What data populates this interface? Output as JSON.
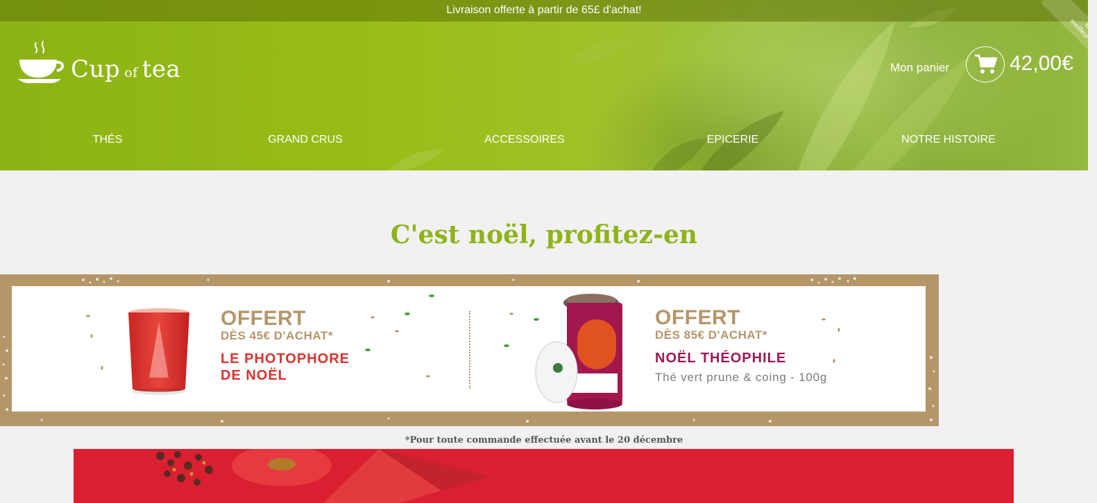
{
  "topbar": {
    "message": "Livraison offerte à partir de 65£ d'achat!"
  },
  "logo": {
    "word1": "Cup",
    "word2": "of",
    "word3": "tea"
  },
  "cart": {
    "label": "Mon panier",
    "total": "42,00€"
  },
  "ribbon": {
    "line1": "Élu",
    "line2": "meilleur thé"
  },
  "nav": {
    "items": [
      {
        "label": "THÉS"
      },
      {
        "label": "GRAND CRUS"
      },
      {
        "label": "ACCESSOIRES"
      },
      {
        "label": "EPICERIE"
      },
      {
        "label": "NOTRE HISTOIRE"
      }
    ]
  },
  "main": {
    "title": "C'est noël, profitez-en",
    "promo": {
      "left": {
        "title": "OFFERT",
        "subtitle": "DÈS 45€ D'ACHAT*",
        "name_line1": "LE PHOTOPHORE",
        "name_line2": "DE NOËL"
      },
      "right": {
        "title": "OFFERT",
        "subtitle": "DÈS 85€ D'ACHAT*",
        "name": "NOËL THÉOPHILE",
        "description": "Thé vert prune & coing - 100g"
      }
    },
    "footnote": "*Pour toute commande effectuée avant le 20 décembre"
  },
  "colors": {
    "brand_green": "#8fb31a",
    "promo_tan": "#b49669",
    "candle_red": "#d8332f",
    "theophile_purple": "#9b1a56",
    "banner_red": "#d91f30"
  },
  "icons": {
    "logo": "teacup-icon",
    "cart": "shopping-cart-icon"
  }
}
